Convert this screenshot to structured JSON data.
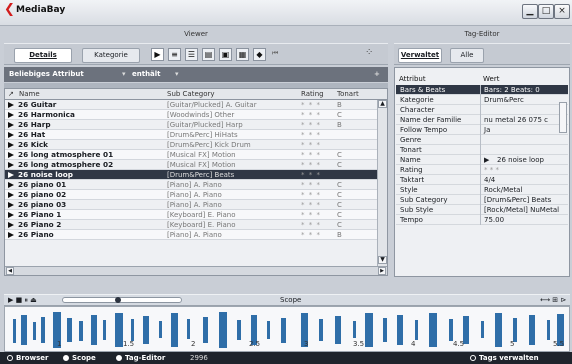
{
  "app": {
    "title": "MediaBay"
  },
  "sections": {
    "viewer": "Viewer",
    "tag_editor": "Tag-Editor",
    "scope": "Scope"
  },
  "tabs": {
    "details": "Details",
    "kategorie": "Kategorie",
    "verwaltet": "Verwaltet",
    "alle": "Alle"
  },
  "filter": {
    "attribute": "Beliebiges Attribut",
    "operator": "enthält"
  },
  "columns": [
    "Name",
    "Sub Category",
    "Rating",
    "Tonart"
  ],
  "rows": [
    {
      "name": "26 Guitar",
      "cat": "[Guitar/Plucked] A. Guitar",
      "rating": "* * *",
      "tonart": "B"
    },
    {
      "name": "26 Harmonica",
      "cat": "[Woodwinds] Other",
      "rating": "* * *",
      "tonart": "C"
    },
    {
      "name": "26 Harp",
      "cat": "[Guitar/Plucked] Harp",
      "rating": "* * *",
      "tonart": "B"
    },
    {
      "name": "26 Hat",
      "cat": "[Drum&Perc] HiHats",
      "rating": "* * *",
      "tonart": ""
    },
    {
      "name": "26 Kick",
      "cat": "[Drum&Perc] Kick Drum",
      "rating": "* * *",
      "tonart": ""
    },
    {
      "name": "26 long atmosphere 01",
      "cat": "[Musical FX] Motion",
      "rating": "* * *",
      "tonart": "C"
    },
    {
      "name": "26 long atmosphere 02",
      "cat": "[Musical FX] Motion",
      "rating": "* * *",
      "tonart": "C"
    },
    {
      "name": "26 noise loop",
      "cat": "[Drum&Perc] Beats",
      "rating": "* * *",
      "tonart": "",
      "selected": true
    },
    {
      "name": "26 piano 01",
      "cat": "[Piano] A. Piano",
      "rating": "* * *",
      "tonart": "C"
    },
    {
      "name": "26 piano 02",
      "cat": "[Piano] A. Piano",
      "rating": "* * *",
      "tonart": "C"
    },
    {
      "name": "26 piano 03",
      "cat": "[Piano] A. Piano",
      "rating": "* * *",
      "tonart": "C"
    },
    {
      "name": "26 Piano 1",
      "cat": "[Keyboard] E. Piano",
      "rating": "* * *",
      "tonart": "C"
    },
    {
      "name": "26 Piano 2",
      "cat": "[Keyboard] E. Piano",
      "rating": "* * *",
      "tonart": "C"
    },
    {
      "name": "26 Piano",
      "cat": "[Piano] A. Piano",
      "rating": "* * *",
      "tonart": "B"
    }
  ],
  "tagtable": {
    "headers": [
      "Attribut",
      "Wert"
    ],
    "rows": [
      {
        "key": "Bars & Beats",
        "value": "Bars: 2 Beats: 0",
        "selected": true
      },
      {
        "key": "Kategorie",
        "value": "Drum&Perc"
      },
      {
        "key": "Character",
        "value": ""
      },
      {
        "key": "Name der Familie",
        "value": "nu metal 26 075 c"
      },
      {
        "key": "Follow Tempo",
        "value": "Ja"
      },
      {
        "key": "Genre",
        "value": ""
      },
      {
        "key": "Tonart",
        "value": ""
      },
      {
        "key": "Name",
        "value": "26 noise loop",
        "value_icon": "play-triangle-icon"
      },
      {
        "key": "Rating",
        "value": "* * *"
      },
      {
        "key": "Taktart",
        "value": "4/4"
      },
      {
        "key": "Style",
        "value": "Rock/Metal"
      },
      {
        "key": "Sub Category",
        "value": "[Drum&Perc] Beats"
      },
      {
        "key": "Sub Style",
        "value": "[Rock/Metal] NuMetal"
      },
      {
        "key": "Tempo",
        "value": "75.00"
      }
    ]
  },
  "scope_marks": [
    "1",
    "1.5",
    "2",
    "2.5",
    "3",
    "3.5",
    "4",
    "4.5",
    "5",
    "5.5"
  ],
  "bottombar": {
    "browser": "Browser",
    "scope": "Scope",
    "tag_editor": "Tag-Editor",
    "count": "2996",
    "tags": "Tags verwalten"
  }
}
